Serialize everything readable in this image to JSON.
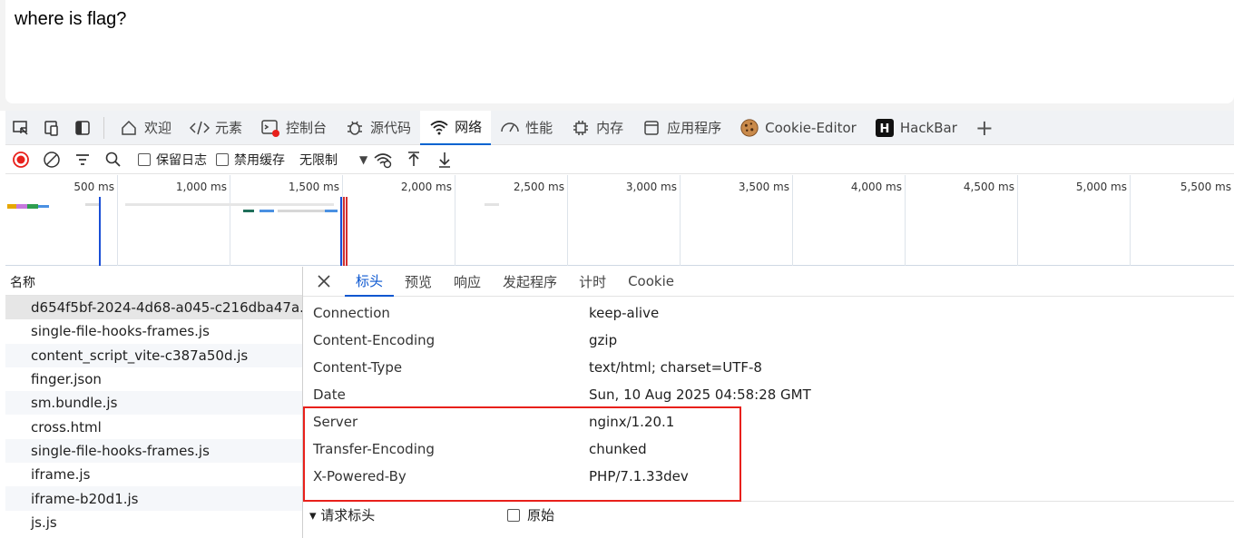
{
  "page": {
    "text": "where is flag?"
  },
  "devtools_tabs": [
    {
      "label": "欢迎",
      "icon": "home-icon"
    },
    {
      "label": "元素",
      "icon": "code-icon"
    },
    {
      "label": "控制台",
      "icon": "console-icon"
    },
    {
      "label": "源代码",
      "icon": "bug-icon"
    },
    {
      "label": "网络",
      "icon": "wifi-icon",
      "active": true
    },
    {
      "label": "性能",
      "icon": "performance-icon"
    },
    {
      "label": "内存",
      "icon": "memory-icon"
    },
    {
      "label": "应用程序",
      "icon": "application-icon"
    },
    {
      "label": "Cookie-Editor",
      "icon": "cookie-icon"
    },
    {
      "label": "HackBar",
      "icon": "hackbar-icon"
    }
  ],
  "toolbar": {
    "preserve_log": "保留日志",
    "disable_cache": "禁用缓存",
    "throttle": "无限制"
  },
  "timeline": {
    "ticks": [
      "500 ms",
      "1,000 ms",
      "1,500 ms",
      "2,000 ms",
      "2,500 ms",
      "3,000 ms",
      "3,500 ms",
      "4,000 ms",
      "4,500 ms",
      "5,000 ms",
      "5,500 ms"
    ]
  },
  "request_list": {
    "header": "名称",
    "rows": [
      "d654f5bf-2024-4d68-a045-c216dba47a...",
      "single-file-hooks-frames.js",
      "content_script_vite-c387a50d.js",
      "finger.json",
      "sm.bundle.js",
      "cross.html",
      "single-file-hooks-frames.js",
      "iframe.js",
      "iframe-b20d1.js",
      "js.js"
    ]
  },
  "details": {
    "tabs": [
      "标头",
      "预览",
      "响应",
      "发起程序",
      "计时",
      "Cookie"
    ],
    "headers": [
      {
        "name": "Connection",
        "value": "keep-alive"
      },
      {
        "name": "Content-Encoding",
        "value": "gzip"
      },
      {
        "name": "Content-Type",
        "value": "text/html; charset=UTF-8"
      },
      {
        "name": "Date",
        "value": "Sun, 10 Aug 2025 04:58:28 GMT"
      },
      {
        "name": "Server",
        "value": "nginx/1.20.1"
      },
      {
        "name": "Transfer-Encoding",
        "value": "chunked"
      },
      {
        "name": "X-Powered-By",
        "value": "PHP/7.1.33dev"
      }
    ],
    "request_headers_title": "▾ 请求标头",
    "raw_label": "原始"
  },
  "colors": {
    "accent": "#0063d0",
    "highlight": "#e8201b",
    "record": "#e8201b"
  }
}
